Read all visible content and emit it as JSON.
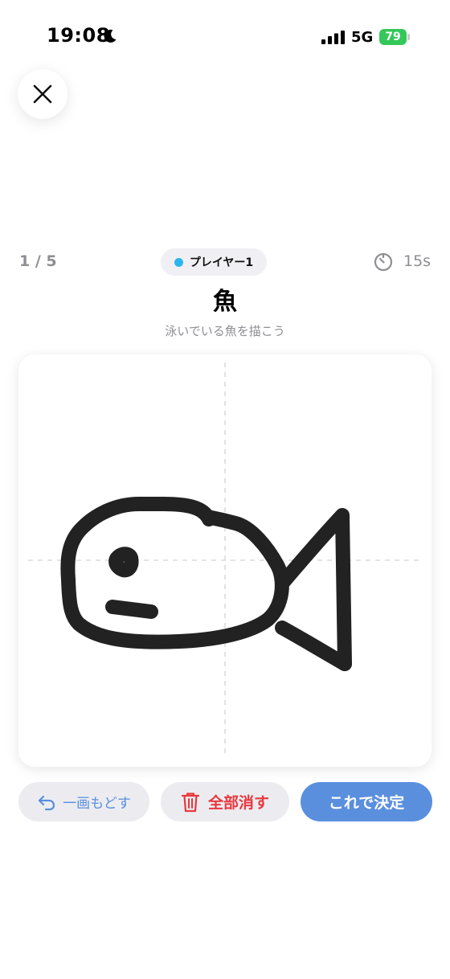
{
  "status_bar": {
    "time": "19:08",
    "network": "5G",
    "battery": "79",
    "icons": [
      "moon-icon",
      "signal-icon",
      "battery-icon"
    ],
    "battery_color": "#34c759"
  },
  "close_button": {
    "icon": "close-icon"
  },
  "game": {
    "progress": "1 / 5",
    "player": "プレイヤー1",
    "player_color": "#2cb5ea",
    "timer": "15s",
    "word": "魚",
    "hint": "泳いでいる魚を描こう"
  },
  "actions": {
    "undo_label": "一画もどす",
    "clear_label": "全部消す",
    "confirm_label": "これで決定",
    "accent_color": "#5a8fde",
    "danger_color": "#e8383d"
  }
}
